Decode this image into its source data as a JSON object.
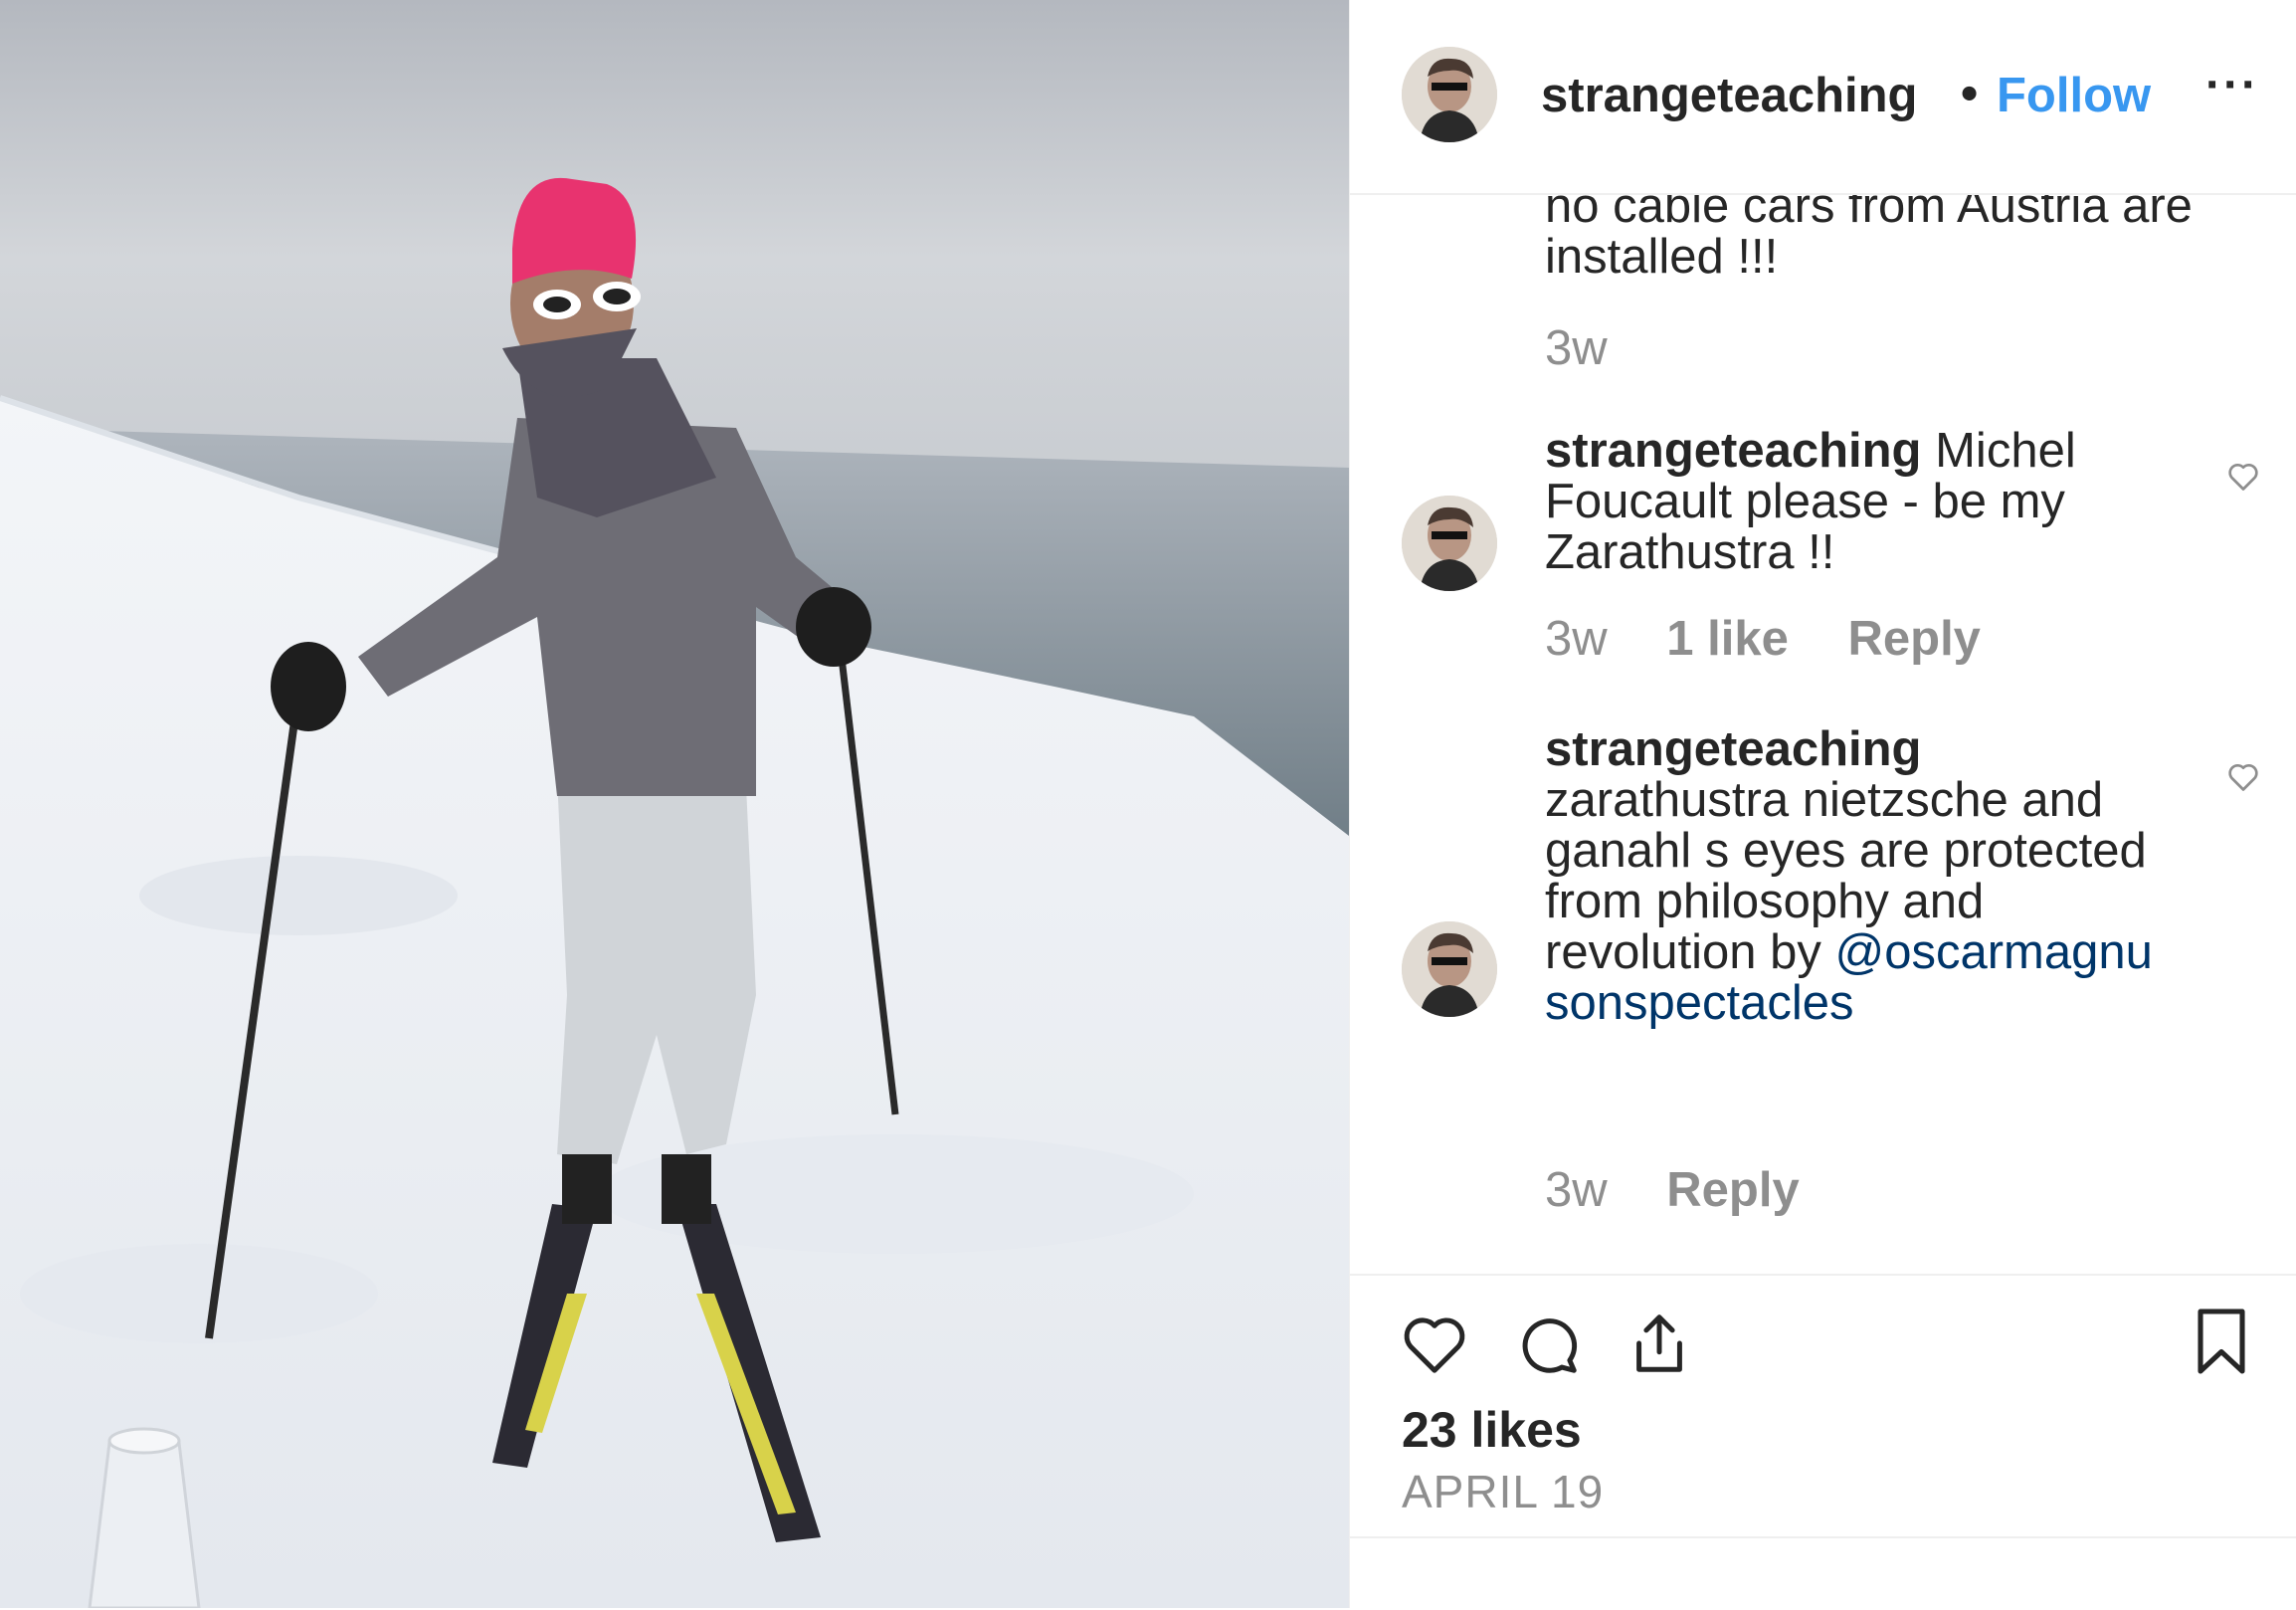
{
  "post": {
    "username": "strangeteaching",
    "follow_label": "Follow",
    "more_label": "···",
    "separator": "•"
  },
  "comments": [
    {
      "text": "no cable cars from Austria are installed !!!",
      "time": "3w"
    },
    {
      "username": "strangeteaching",
      "text": "Michel Foucault please - be my Zarathustra !!",
      "time": "3w",
      "likes": "1 like",
      "reply": "Reply"
    },
    {
      "username": "strangeteaching",
      "text": "zarathustra nietzsche and ganahl s eyes are protected from philosophy and revolution by",
      "mention": "@oscarmagnusonspectacles",
      "time": "3w",
      "reply": "Reply"
    }
  ],
  "footer": {
    "likes_label": "23 likes",
    "date_label": "APRIL 19"
  },
  "icons": [
    "heart-icon",
    "comment-icon",
    "share-icon",
    "bookmark-icon",
    "more-icon"
  ],
  "colors": {
    "follow": "#3897f0",
    "mention": "#003569",
    "muted": "#8e8e8e",
    "hat": "#e8336f"
  }
}
